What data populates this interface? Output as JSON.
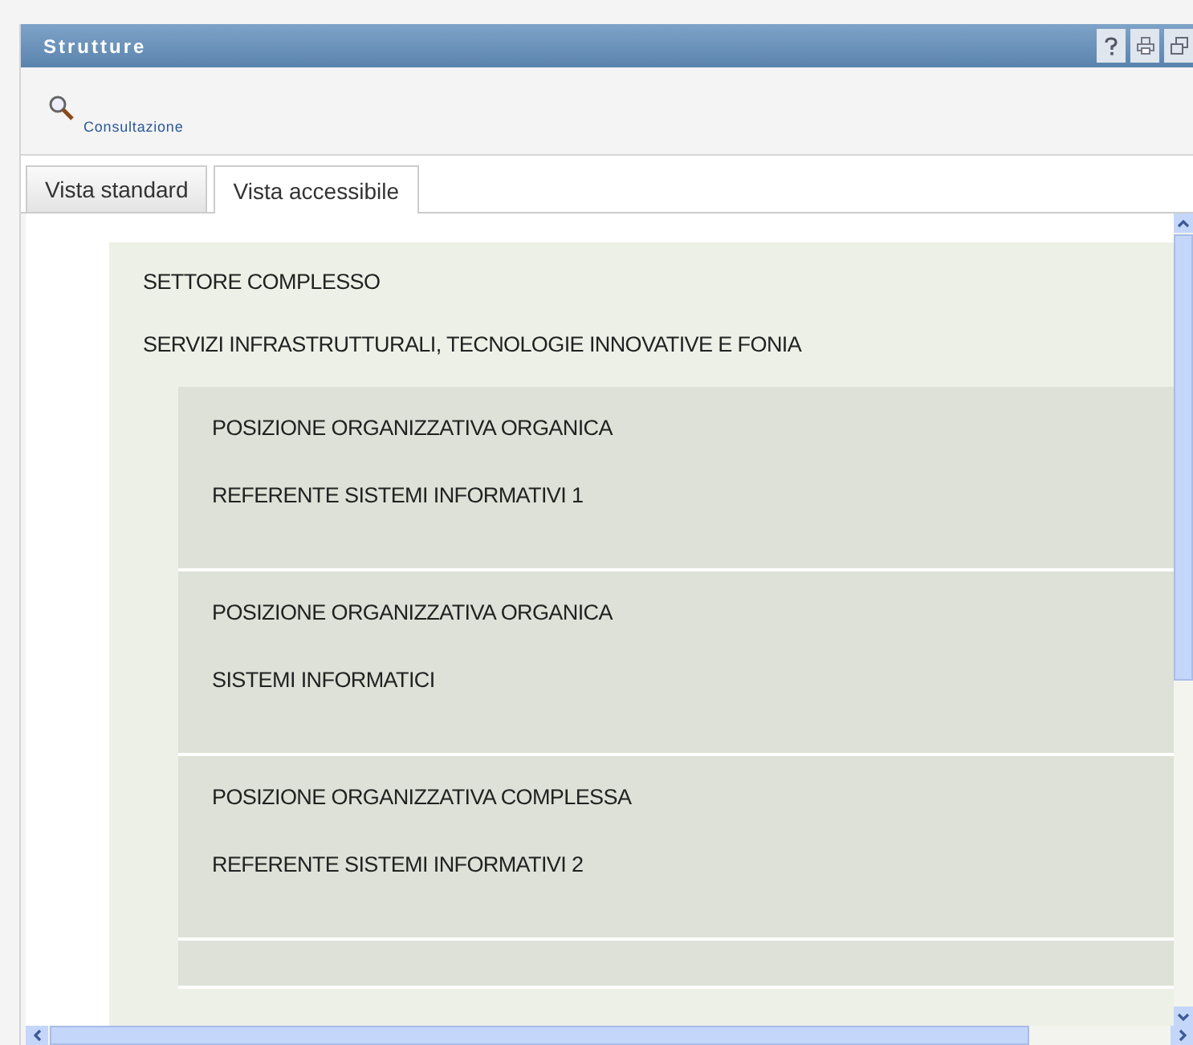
{
  "window": {
    "title": "Strutture"
  },
  "toolbar": {
    "link": "Consultazione"
  },
  "tabs": [
    {
      "label": "Vista standard",
      "selected": false
    },
    {
      "label": "Vista accessibile",
      "selected": true
    }
  ],
  "structure": {
    "type": "SETTORE COMPLESSO",
    "name": "SERVIZI INFRASTRUTTURALI, TECNOLOGIE INNOVATIVE E FONIA",
    "children": [
      {
        "type": "POSIZIONE ORGANIZZATIVA ORGANICA",
        "name": "REFERENTE SISTEMI INFORMATIVI 1"
      },
      {
        "type": "POSIZIONE ORGANIZZATIVA ORGANICA",
        "name": "SISTEMI INFORMATICI"
      },
      {
        "type": "POSIZIONE ORGANIZZATIVA COMPLESSA",
        "name": "REFERENTE SISTEMI INFORMATIVI 2"
      }
    ]
  }
}
